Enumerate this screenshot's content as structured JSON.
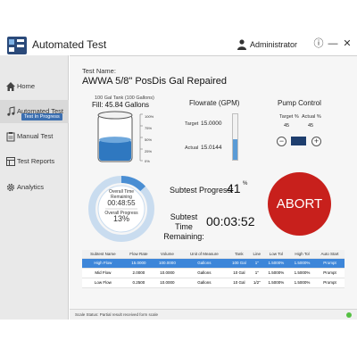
{
  "app": {
    "title": "Automated Test",
    "user": "Administrator"
  },
  "window": {
    "help_glyph": "ⓘ",
    "minimize_glyph": "—",
    "close_glyph": "✕"
  },
  "sidebar": {
    "items": [
      {
        "label": "Home",
        "icon": "home-icon"
      },
      {
        "label": "Automated Test",
        "icon": "music-note-icon",
        "badge": "Test In Progress",
        "active": true
      },
      {
        "label": "Manual Test",
        "icon": "clipboard-icon"
      },
      {
        "label": "Test Reports",
        "icon": "reports-icon"
      },
      {
        "label": "Analytics",
        "icon": "gear-icon"
      }
    ]
  },
  "test": {
    "name_label": "Test Name:",
    "name": "AWWA 5/8\" PosDis Gal Repaired"
  },
  "tank": {
    "label": "100 Gal Tank (100 Gallons)",
    "fill_text": "Fill: 45.84 Gallons",
    "fill_fraction": 0.4584,
    "scale": [
      "100%",
      "75%",
      "50%",
      "25%",
      "0%"
    ]
  },
  "flowrate": {
    "title": "Flowrate (GPM)",
    "target_label": "Target",
    "target": "15.0000",
    "actual_label": "Actual",
    "actual": "15.0144",
    "bar_fraction": 0.45
  },
  "pump": {
    "title": "Pump Control",
    "target_label": "Target %",
    "target": "45",
    "actual_label": "Actual %",
    "actual": "45",
    "minus": "−",
    "plus": "+"
  },
  "gauge": {
    "line1": "Overall Time",
    "line2": "Remaining",
    "time": "00:48:55",
    "progress_label": "Overall Progress",
    "progress": "13%",
    "progress_fraction": 0.13
  },
  "subtest": {
    "progress_label": "Subtest Progress:",
    "progress": "41",
    "progress_unit": "%",
    "time_label": "Subtest Time Remaining:",
    "time": "00:03:52"
  },
  "abort": {
    "label": "ABORT"
  },
  "table": {
    "headers": [
      "Subtest Name",
      "Flow Rate",
      "Volume",
      "Unit of Measure",
      "Tank",
      "Line",
      "Low Tol",
      "High Tol",
      "Auto Start"
    ],
    "rows": [
      [
        "High Flow",
        "15.0000",
        "100.0000",
        "Gallons",
        "100 Gal",
        "1\"",
        "1.5000%",
        "1.5000%",
        "Prompt"
      ],
      [
        "Mid Flow",
        "2.0000",
        "10.0000",
        "Gallons",
        "10 Gal",
        "1\"",
        "1.5000%",
        "1.5000%",
        "Prompt"
      ],
      [
        "Low Flow",
        "0.2500",
        "10.0000",
        "Gallons",
        "10 Gal",
        "1/2\"",
        "1.5000%",
        "1.5000%",
        "Prompt"
      ]
    ],
    "selected_row": 0
  },
  "status": {
    "text": "Scale Status:     Partial result received form scale"
  },
  "colors": {
    "accent": "#3c6fb0",
    "abort": "#c8201c",
    "water": "#2f78c0",
    "status_ok": "#55c043"
  }
}
